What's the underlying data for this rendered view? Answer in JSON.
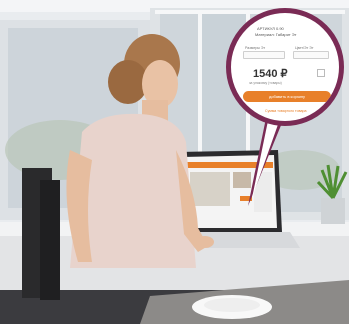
{
  "scene": {
    "description_colors": {
      "bubble_border": "#7a2b55",
      "accent": "#e8802a"
    },
    "bubble": {
      "article_text": "АРТИКУЛ 0.90",
      "seller_text": "Материал: Габарит Эт",
      "size_label": "Размеры Эт",
      "quantity_label": "Цвет/Эт Эт",
      "price": "1540 ₽",
      "price_note": "за упаковку (товары)",
      "cart_button_label": "добавить в корзину",
      "link_label": "Сумма товарного товара"
    }
  }
}
